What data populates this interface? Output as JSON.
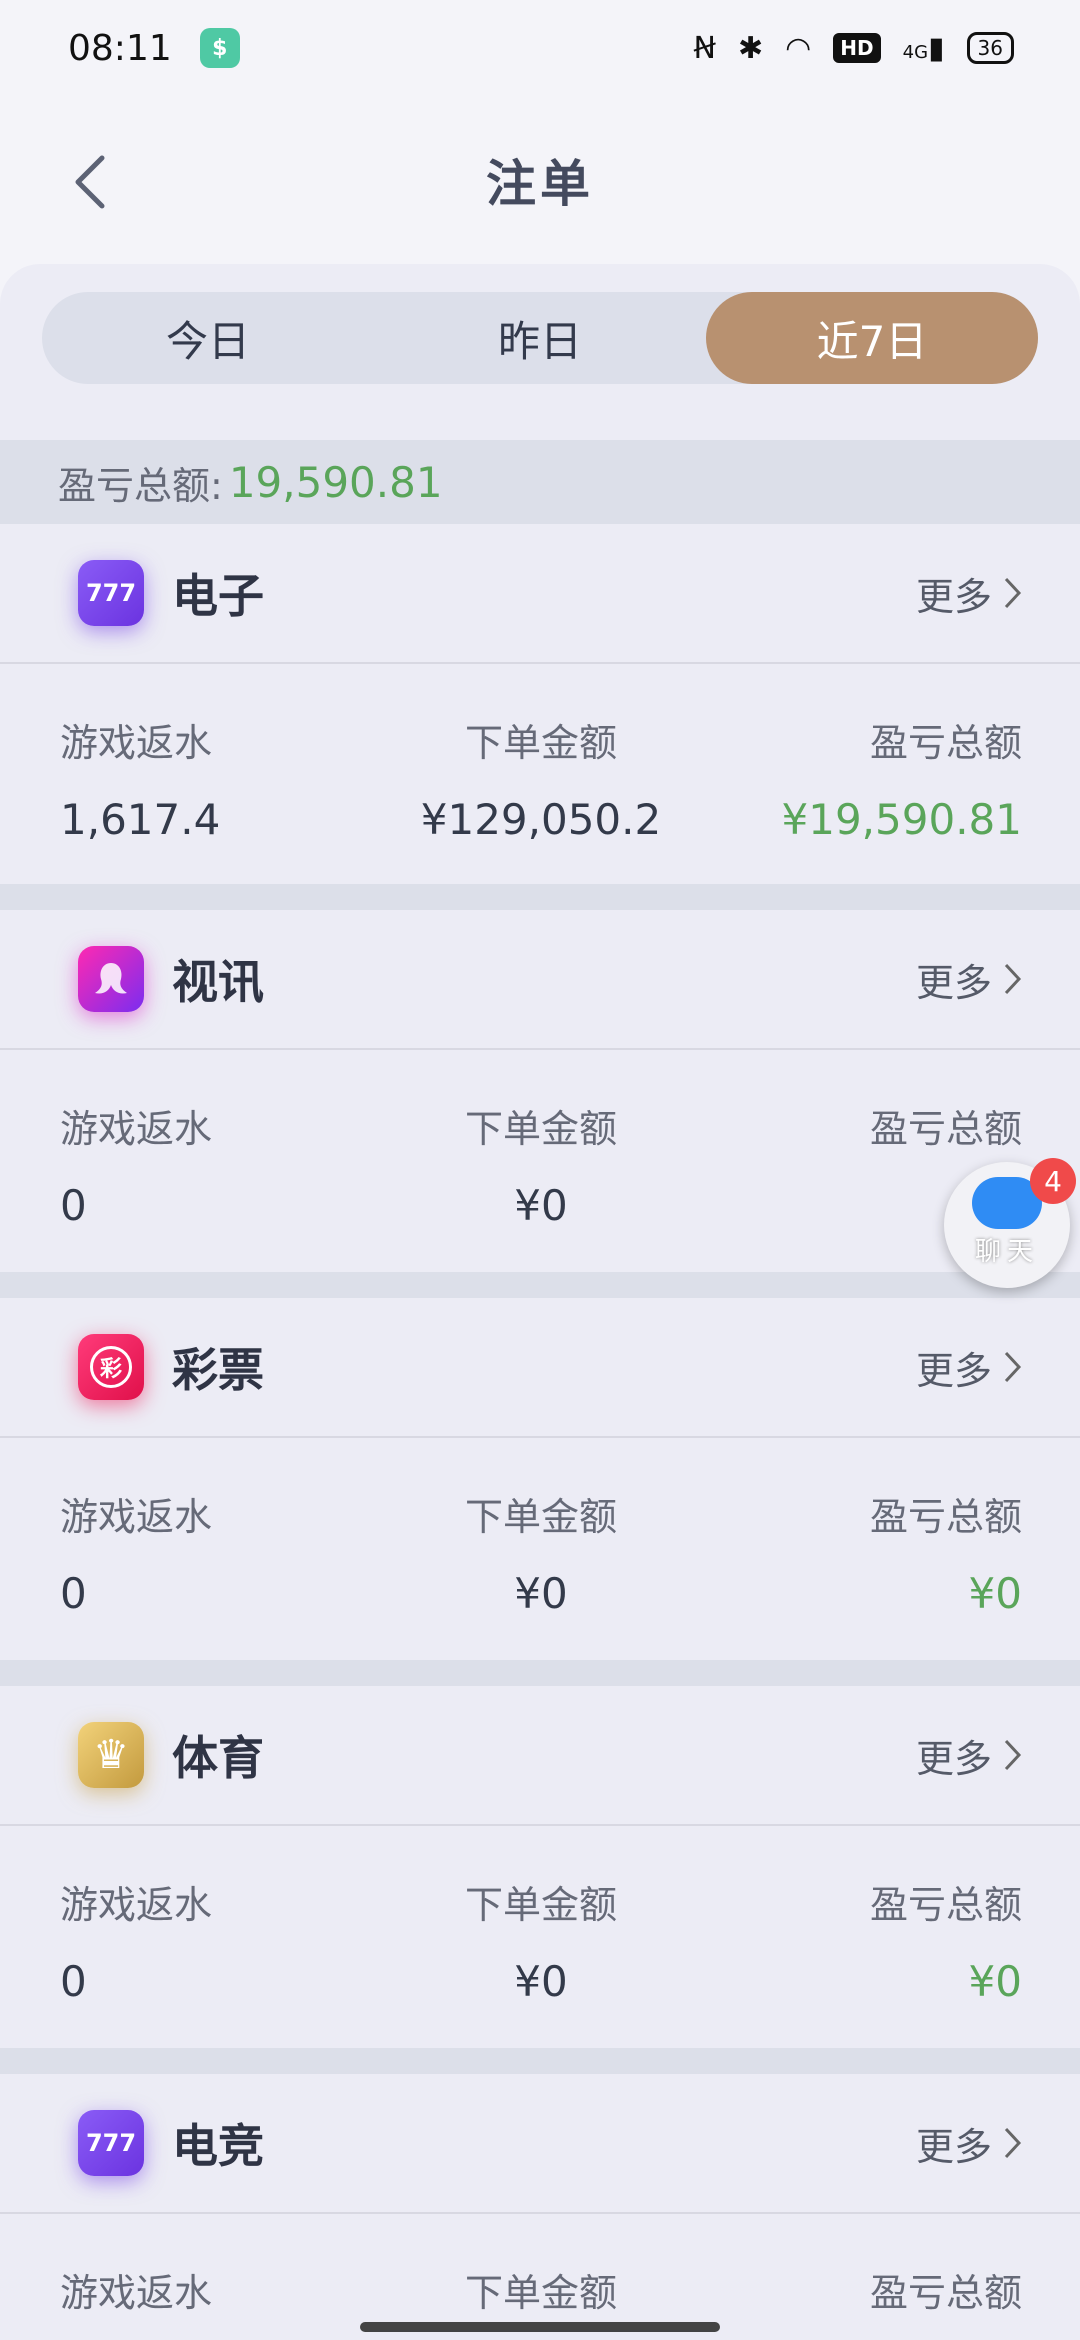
{
  "status_bar": {
    "time": "08:11",
    "app_badge": "$",
    "icons": [
      "nfc-icon",
      "bluetooth-icon",
      "wifi-icon",
      "hd-icon",
      "signal-4g-icon"
    ],
    "hd": "HD",
    "network": "4G",
    "battery": "36"
  },
  "header": {
    "title": "注单"
  },
  "tabs": [
    {
      "label": "今日",
      "active": false
    },
    {
      "label": "昨日",
      "active": false
    },
    {
      "label": "近7日",
      "active": true
    }
  ],
  "summary": {
    "label": "盈亏总额:",
    "value": "19,590.81"
  },
  "columns": {
    "rebate": "游戏返水",
    "bet": "下单金额",
    "profit": "盈亏总额"
  },
  "more_label": "更多",
  "sections": [
    {
      "name": "电子",
      "icon": "slot-777-icon",
      "icon_text": "777",
      "rebate": "1,617.4",
      "bet": "¥129,050.2",
      "profit": "¥19,590.81"
    },
    {
      "name": "视讯",
      "icon": "live-video-icon",
      "icon_text": "",
      "rebate": "0",
      "bet": "¥0",
      "profit": ""
    },
    {
      "name": "彩票",
      "icon": "lottery-icon",
      "icon_text": "彩",
      "rebate": "0",
      "bet": "¥0",
      "profit": "¥0"
    },
    {
      "name": "体育",
      "icon": "sport-crown-icon",
      "icon_text": "♛",
      "rebate": "0",
      "bet": "¥0",
      "profit": "¥0"
    },
    {
      "name": "电竞",
      "icon": "esport-777-icon",
      "icon_text": "777",
      "rebate": "",
      "bet": "",
      "profit": ""
    }
  ],
  "chat": {
    "label": "聊天",
    "badge": "4"
  },
  "colors": {
    "accent": "#b89170",
    "profit_green": "#5aa55a"
  }
}
